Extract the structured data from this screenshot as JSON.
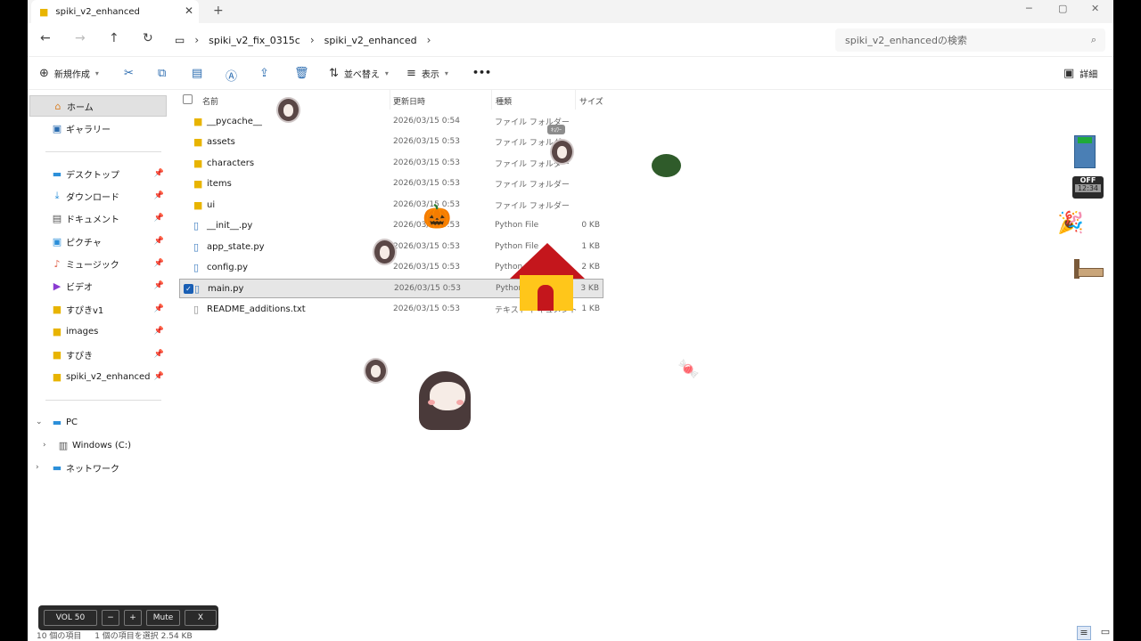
{
  "tab": {
    "title": "spiki_v2_enhanced",
    "close": "✕",
    "new": "+"
  },
  "window_controls": {
    "minimize": "─",
    "maximize": "▢",
    "close": "✕"
  },
  "nav": {
    "back": "←",
    "forward": "→",
    "up": "↑",
    "refresh": "↻"
  },
  "breadcrumb": {
    "root_icon": "▭",
    "items": [
      "spiki_v2_fix_0315c",
      "spiki_v2_enhanced"
    ],
    "sep": "›"
  },
  "search": {
    "placeholder": "spiki_v2_enhancedの検索",
    "icon": "⌕"
  },
  "commands": {
    "new": "新規作成",
    "sort": "並べ替え",
    "view": "表示",
    "more": "•••",
    "details": "詳細"
  },
  "sidebar": {
    "home": "ホーム",
    "gallery": "ギャラリー",
    "quick": [
      {
        "label": "デスクトップ",
        "icon": "desktop-icon"
      },
      {
        "label": "ダウンロード",
        "icon": "download-icon"
      },
      {
        "label": "ドキュメント",
        "icon": "document-icon"
      },
      {
        "label": "ピクチャ",
        "icon": "picture-icon"
      },
      {
        "label": "ミュージック",
        "icon": "music-icon"
      },
      {
        "label": "ビデオ",
        "icon": "video-icon"
      },
      {
        "label": "すぴきv1",
        "icon": "folder-icon"
      },
      {
        "label": "images",
        "icon": "folder-icon"
      },
      {
        "label": "すぴき",
        "icon": "folder-icon"
      },
      {
        "label": "spiki_v2_enhanced",
        "icon": "folder-icon"
      }
    ],
    "pc": "PC",
    "drive": "Windows (C:)",
    "network": "ネットワーク"
  },
  "columns": {
    "name": "名前",
    "date": "更新日時",
    "type": "種類",
    "size": "サイズ"
  },
  "files": [
    {
      "name": "__pycache__",
      "date": "2026/03/15 0:54",
      "type": "ファイル フォルダー",
      "size": "",
      "kind": "folder"
    },
    {
      "name": "assets",
      "date": "2026/03/15 0:53",
      "type": "ファイル フォルダー",
      "size": "",
      "kind": "folder"
    },
    {
      "name": "characters",
      "date": "2026/03/15 0:53",
      "type": "ファイル フォルダー",
      "size": "",
      "kind": "folder"
    },
    {
      "name": "items",
      "date": "2026/03/15 0:53",
      "type": "ファイル フォルダー",
      "size": "",
      "kind": "folder"
    },
    {
      "name": "ui",
      "date": "2026/03/15 0:53",
      "type": "ファイル フォルダー",
      "size": "",
      "kind": "folder"
    },
    {
      "name": "__init__.py",
      "date": "2026/03/15 0:53",
      "type": "Python File",
      "size": "0 KB",
      "kind": "py"
    },
    {
      "name": "app_state.py",
      "date": "2026/03/15 0:53",
      "type": "Python File",
      "size": "1 KB",
      "kind": "py"
    },
    {
      "name": "config.py",
      "date": "2026/03/15 0:53",
      "type": "Python File",
      "size": "2 KB",
      "kind": "py"
    },
    {
      "name": "main.py",
      "date": "2026/03/15 0:53",
      "type": "Python File",
      "size": "3 KB",
      "kind": "py",
      "selected": true
    },
    {
      "name": "README_additions.txt",
      "date": "2026/03/15 0:53",
      "type": "テキスト ドキュメント",
      "size": "1 KB",
      "kind": "txt"
    }
  ],
  "status": {
    "count": "10 個の項目",
    "selection": "1 個の項目を選択 2.54 KB"
  },
  "volume": {
    "label": "VOL 50",
    "minus": "−",
    "plus": "+",
    "mute": "Mute",
    "close": "X"
  },
  "speech_bubble": "ｷｮﾜｰ",
  "clock_widget": {
    "state": "OFF",
    "time": "12:34"
  }
}
